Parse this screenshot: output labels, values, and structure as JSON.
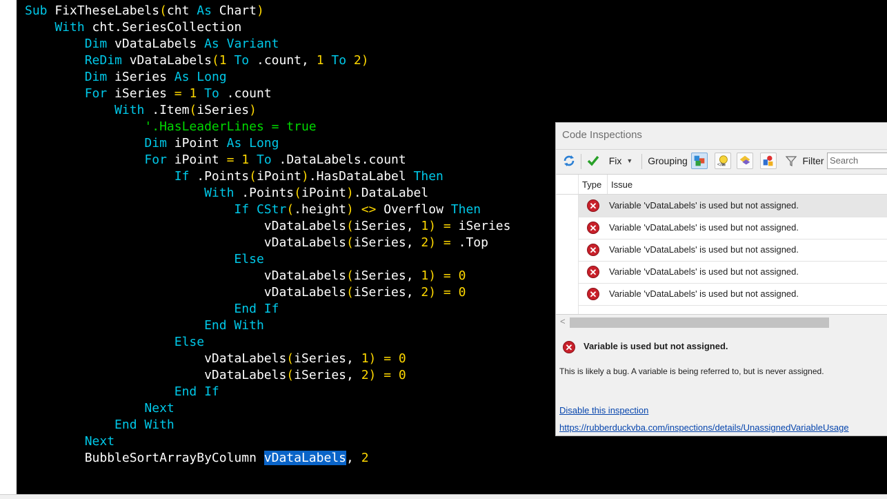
{
  "code": {
    "lines": [
      [
        {
          "t": "Sub ",
          "c": "kw"
        },
        {
          "t": "FixTheseLabels",
          "c": ""
        },
        {
          "t": "(",
          "c": "paren"
        },
        {
          "t": "cht ",
          "c": ""
        },
        {
          "t": "As ",
          "c": "kw"
        },
        {
          "t": "Chart",
          "c": ""
        },
        {
          "t": ")",
          "c": "paren"
        }
      ],
      [
        {
          "t": "    With ",
          "c": "kw"
        },
        {
          "t": "cht.SeriesCollection",
          "c": ""
        }
      ],
      [
        {
          "t": "        Dim ",
          "c": "kw"
        },
        {
          "t": "vDataLabels ",
          "c": ""
        },
        {
          "t": "As ",
          "c": "kw"
        },
        {
          "t": "Variant",
          "c": "kw"
        }
      ],
      [
        {
          "t": "        ReDim ",
          "c": "kw"
        },
        {
          "t": "vDataLabels",
          "c": ""
        },
        {
          "t": "(",
          "c": "paren"
        },
        {
          "t": "1 ",
          "c": "num"
        },
        {
          "t": "To ",
          "c": "kw"
        },
        {
          "t": ".count, ",
          "c": ""
        },
        {
          "t": "1 ",
          "c": "num"
        },
        {
          "t": "To ",
          "c": "kw"
        },
        {
          "t": "2",
          "c": "num"
        },
        {
          "t": ")",
          "c": "paren"
        }
      ],
      [
        {
          "t": "        Dim ",
          "c": "kw"
        },
        {
          "t": "iSeries ",
          "c": ""
        },
        {
          "t": "As ",
          "c": "kw"
        },
        {
          "t": "Long",
          "c": "kw"
        }
      ],
      [
        {
          "t": "        For ",
          "c": "kw"
        },
        {
          "t": "iSeries ",
          "c": ""
        },
        {
          "t": "= ",
          "c": "op"
        },
        {
          "t": "1 ",
          "c": "num"
        },
        {
          "t": "To ",
          "c": "kw"
        },
        {
          "t": ".count",
          "c": ""
        }
      ],
      [
        {
          "t": "            With ",
          "c": "kw"
        },
        {
          "t": ".Item",
          "c": ""
        },
        {
          "t": "(",
          "c": "paren"
        },
        {
          "t": "iSeries",
          "c": ""
        },
        {
          "t": ")",
          "c": "paren"
        }
      ],
      [
        {
          "t": "                '.HasLeaderLines = true",
          "c": "comment"
        }
      ],
      [
        {
          "t": "                Dim ",
          "c": "kw"
        },
        {
          "t": "iPoint ",
          "c": ""
        },
        {
          "t": "As ",
          "c": "kw"
        },
        {
          "t": "Long",
          "c": "kw"
        }
      ],
      [
        {
          "t": "                For ",
          "c": "kw"
        },
        {
          "t": "iPoint ",
          "c": ""
        },
        {
          "t": "= ",
          "c": "op"
        },
        {
          "t": "1 ",
          "c": "num"
        },
        {
          "t": "To ",
          "c": "kw"
        },
        {
          "t": ".DataLabels.count",
          "c": ""
        }
      ],
      [
        {
          "t": "                    If ",
          "c": "kw"
        },
        {
          "t": ".Points",
          "c": ""
        },
        {
          "t": "(",
          "c": "paren"
        },
        {
          "t": "iPoint",
          "c": ""
        },
        {
          "t": ")",
          "c": "paren"
        },
        {
          "t": ".HasDataLabel ",
          "c": ""
        },
        {
          "t": "Then",
          "c": "kw"
        }
      ],
      [
        {
          "t": "                        With ",
          "c": "kw"
        },
        {
          "t": ".Points",
          "c": ""
        },
        {
          "t": "(",
          "c": "paren"
        },
        {
          "t": "iPoint",
          "c": ""
        },
        {
          "t": ")",
          "c": "paren"
        },
        {
          "t": ".DataLabel",
          "c": ""
        }
      ],
      [
        {
          "t": "                            If ",
          "c": "kw"
        },
        {
          "t": "CStr",
          "c": "kw"
        },
        {
          "t": "(",
          "c": "paren"
        },
        {
          "t": ".height",
          "c": ""
        },
        {
          "t": ") ",
          "c": "paren"
        },
        {
          "t": "<> ",
          "c": "op"
        },
        {
          "t": "Overflow ",
          "c": ""
        },
        {
          "t": "Then",
          "c": "kw"
        }
      ],
      [
        {
          "t": "                                vDataLabels",
          "c": ""
        },
        {
          "t": "(",
          "c": "paren"
        },
        {
          "t": "iSeries, ",
          "c": ""
        },
        {
          "t": "1",
          "c": "num"
        },
        {
          "t": ") ",
          "c": "paren"
        },
        {
          "t": "= ",
          "c": "op"
        },
        {
          "t": "iSeries",
          "c": ""
        }
      ],
      [
        {
          "t": "                                vDataLabels",
          "c": ""
        },
        {
          "t": "(",
          "c": "paren"
        },
        {
          "t": "iSeries, ",
          "c": ""
        },
        {
          "t": "2",
          "c": "num"
        },
        {
          "t": ") ",
          "c": "paren"
        },
        {
          "t": "= ",
          "c": "op"
        },
        {
          "t": ".Top",
          "c": ""
        }
      ],
      [
        {
          "t": "                            Else",
          "c": "kw"
        }
      ],
      [
        {
          "t": "                                vDataLabels",
          "c": ""
        },
        {
          "t": "(",
          "c": "paren"
        },
        {
          "t": "iSeries, ",
          "c": ""
        },
        {
          "t": "1",
          "c": "num"
        },
        {
          "t": ") ",
          "c": "paren"
        },
        {
          "t": "= ",
          "c": "op"
        },
        {
          "t": "0",
          "c": "num"
        }
      ],
      [
        {
          "t": "                                vDataLabels",
          "c": ""
        },
        {
          "t": "(",
          "c": "paren"
        },
        {
          "t": "iSeries, ",
          "c": ""
        },
        {
          "t": "2",
          "c": "num"
        },
        {
          "t": ") ",
          "c": "paren"
        },
        {
          "t": "= ",
          "c": "op"
        },
        {
          "t": "0",
          "c": "num"
        }
      ],
      [
        {
          "t": "                            End If",
          "c": "kw"
        }
      ],
      [
        {
          "t": "                        End With",
          "c": "kw"
        }
      ],
      [
        {
          "t": "                    Else",
          "c": "kw"
        }
      ],
      [
        {
          "t": "                        vDataLabels",
          "c": ""
        },
        {
          "t": "(",
          "c": "paren"
        },
        {
          "t": "iSeries, ",
          "c": ""
        },
        {
          "t": "1",
          "c": "num"
        },
        {
          "t": ") ",
          "c": "paren"
        },
        {
          "t": "= ",
          "c": "op"
        },
        {
          "t": "0",
          "c": "num"
        }
      ],
      [
        {
          "t": "                        vDataLabels",
          "c": ""
        },
        {
          "t": "(",
          "c": "paren"
        },
        {
          "t": "iSeries, ",
          "c": ""
        },
        {
          "t": "2",
          "c": "num"
        },
        {
          "t": ") ",
          "c": "paren"
        },
        {
          "t": "= ",
          "c": "op"
        },
        {
          "t": "0",
          "c": "num"
        }
      ],
      [
        {
          "t": "                    End If",
          "c": "kw"
        }
      ],
      [
        {
          "t": "                Next",
          "c": "kw"
        }
      ],
      [
        {
          "t": "            End With",
          "c": "kw"
        }
      ],
      [
        {
          "t": "        Next",
          "c": "kw"
        }
      ],
      [
        {
          "t": "        BubbleSortArrayByColumn ",
          "c": ""
        },
        {
          "t": "vDataLabels",
          "c": "sel"
        },
        {
          "t": ", ",
          "c": ""
        },
        {
          "t": "2",
          "c": "num"
        }
      ]
    ]
  },
  "panel": {
    "title": "Code Inspections",
    "toolbar": {
      "fix_label": "Fix",
      "grouping_label": "Grouping",
      "filter_label": "Filter",
      "search_placeholder": "Search"
    },
    "columns": {
      "type": "Type",
      "issue": "Issue"
    },
    "rows": [
      {
        "issue": "Variable 'vDataLabels' is used but not assigned.",
        "selected": true
      },
      {
        "issue": "Variable 'vDataLabels' is used but not assigned.",
        "selected": false
      },
      {
        "issue": "Variable 'vDataLabels' is used but not assigned.",
        "selected": false
      },
      {
        "issue": "Variable 'vDataLabels' is used but not assigned.",
        "selected": false
      },
      {
        "issue": "Variable 'vDataLabels' is used but not assigned.",
        "selected": false
      }
    ],
    "detail": {
      "title": "Variable is used but not assigned.",
      "description": "This is likely a bug. A variable is being referred to, but is never assigned.",
      "disable_link": "Disable this inspection",
      "url_link": "https://rubberduckvba.com/inspections/details/UnassignedVariableUsage"
    }
  },
  "colors": {
    "editor_bg": "#000000",
    "keyword": "#00c8e8",
    "literal": "#ffd800",
    "comment": "#00d800",
    "selection": "#0a64c8",
    "error": "#c8202a",
    "link": "#0645ad"
  }
}
